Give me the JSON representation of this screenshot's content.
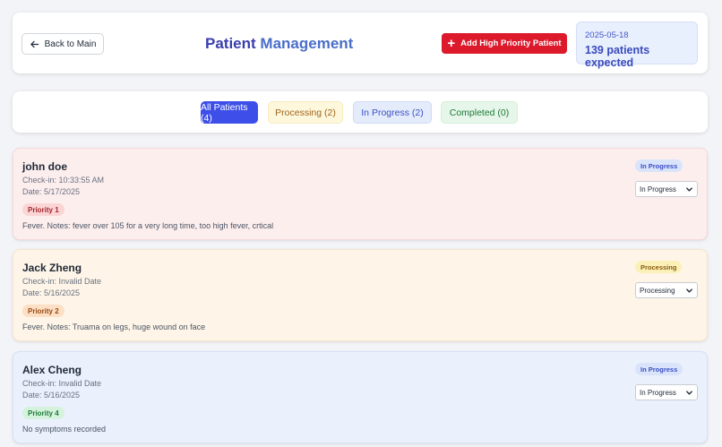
{
  "header": {
    "back_label": "Back to Main",
    "title_part1": "Patient",
    "title_part2": " Management",
    "add_button_label": "Add High Priority Patient",
    "date": "2025-05-18",
    "expected": "139 patients expected"
  },
  "filters": {
    "all": "All Patients (4)",
    "processing": "Processing (2)",
    "in_progress": "In Progress (2)",
    "completed": "Completed (0)",
    "active": "all"
  },
  "patients": [
    {
      "name": "john doe",
      "checkin": "Check-in: 10:33:55 AM",
      "date": "Date: 5/17/2025",
      "priority": "Priority 1",
      "notes": "Fever. Notes: fever over 105 for a very long time, too high fever, crtical",
      "status_badge": "In Progress",
      "status_select": "In Progress"
    },
    {
      "name": "Jack Zheng",
      "checkin": "Check-in: Invalid Date",
      "date": "Date: 5/16/2025",
      "priority": "Priority 2",
      "notes": "Fever. Notes: Truama on legs, huge wound on face",
      "status_badge": "Processing",
      "status_select": "Processing"
    },
    {
      "name": "Alex Cheng",
      "checkin": "Check-in: Invalid Date",
      "date": "Date: 5/16/2025",
      "priority": "Priority 4",
      "notes": "No symptoms recorded",
      "status_badge": "In Progress",
      "status_select": "In Progress"
    }
  ],
  "colors": {
    "accent": "#3e4fe9",
    "danger": "#dc1a2c",
    "priority1": "#fdeeee",
    "priority2": "#fef5e8",
    "priority4": "#eaf1fd"
  },
  "icons": {
    "back": "arrow-left-icon",
    "add": "plus-icon",
    "select": "chevron-down-icon"
  }
}
